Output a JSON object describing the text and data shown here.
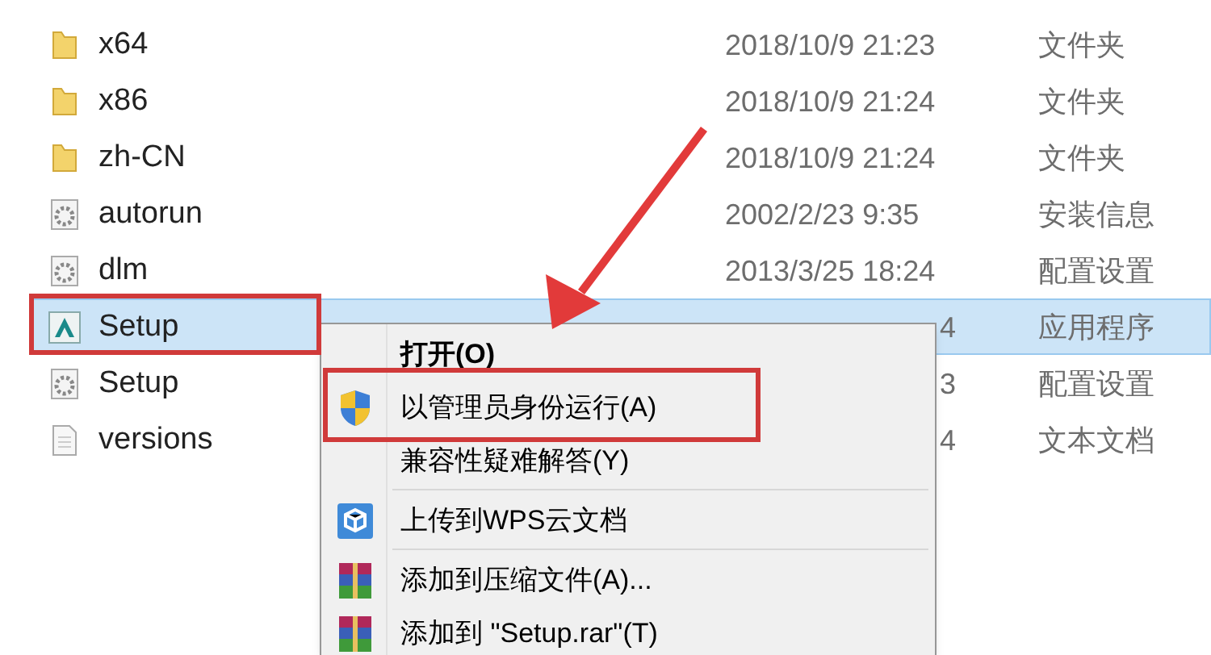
{
  "files": [
    {
      "name": "x64",
      "kind": "folder",
      "date": "2018/10/9 21:23",
      "type": "文件夹",
      "selected": false,
      "obscured": false
    },
    {
      "name": "x86",
      "kind": "folder",
      "date": "2018/10/9 21:24",
      "type": "文件夹",
      "selected": false,
      "obscured": false
    },
    {
      "name": "zh-CN",
      "kind": "folder",
      "date": "2018/10/9 21:24",
      "type": "文件夹",
      "selected": false,
      "obscured": false
    },
    {
      "name": "autorun",
      "kind": "settings",
      "date": "2002/2/23 9:35",
      "type": "安装信息",
      "selected": false,
      "obscured": false
    },
    {
      "name": "dlm",
      "kind": "settings",
      "date": "2013/3/25 18:24",
      "type": "配置设置",
      "selected": false,
      "obscured": false
    },
    {
      "name": "Setup",
      "kind": "app",
      "date": "4",
      "type": "应用程序",
      "selected": true,
      "obscured": true
    },
    {
      "name": "Setup",
      "kind": "settings",
      "date": "3",
      "type": "配置设置",
      "selected": false,
      "obscured": true
    },
    {
      "name": "versions",
      "kind": "text",
      "date": "4",
      "type": "文本文档",
      "selected": false,
      "obscured": true
    }
  ],
  "context_menu": [
    {
      "label": "打开(O)",
      "kind": "default"
    },
    {
      "label": "以管理员身份运行(A)",
      "kind": "admin"
    },
    {
      "label": "兼容性疑难解答(Y)",
      "kind": "plain"
    },
    {
      "kind": "separator"
    },
    {
      "label": "上传到WPS云文档",
      "kind": "upload"
    },
    {
      "kind": "separator"
    },
    {
      "label": "添加到压缩文件(A)...",
      "kind": "archive"
    },
    {
      "label": "添加到 \"Setup.rar\"(T)",
      "kind": "archive"
    }
  ]
}
